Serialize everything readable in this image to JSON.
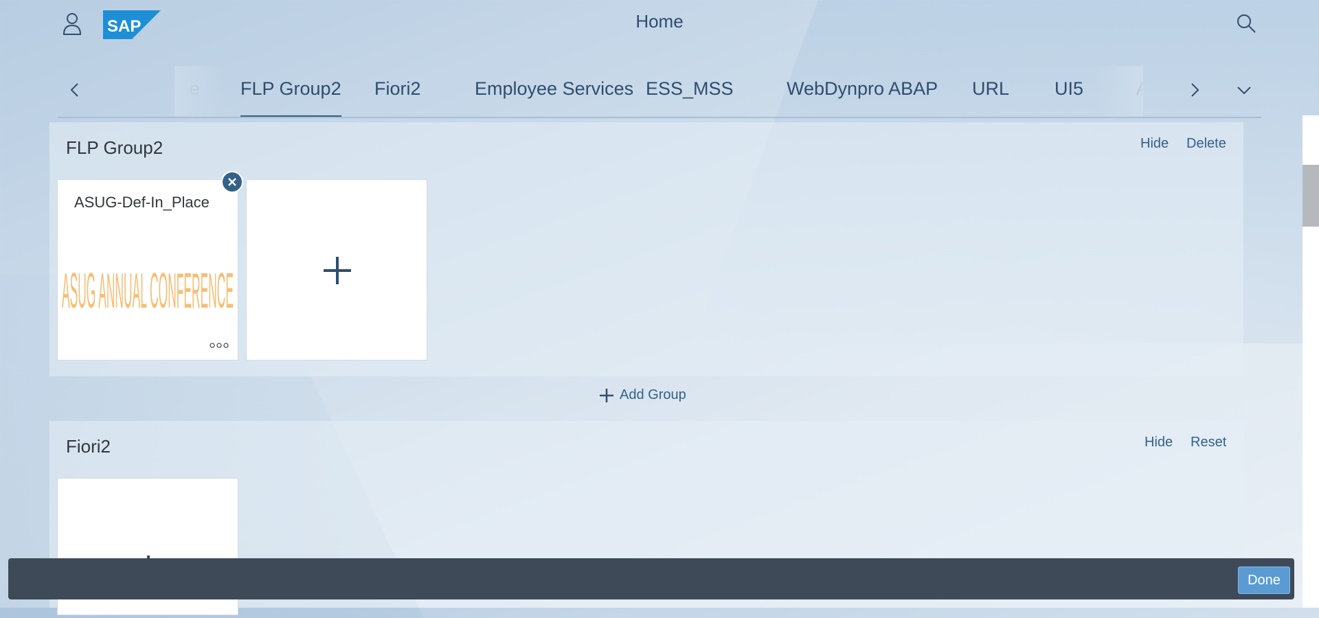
{
  "shell": {
    "title": "Home",
    "logo_text": "SAP",
    "logo_color": "#1e8fd6",
    "user_icon": "person-icon",
    "search_icon": "search-icon"
  },
  "anchor_nav": {
    "tabs": [
      {
        "label": "e",
        "state": "faded"
      },
      {
        "label": "FLP Group2",
        "state": "active"
      },
      {
        "label": "Fiori2",
        "state": "normal"
      },
      {
        "label": "Employee Services",
        "state": "normal"
      },
      {
        "label": "ESS_MSS",
        "state": "normal"
      },
      {
        "label": "WebDynpro ABAP",
        "state": "normal"
      },
      {
        "label": "URL",
        "state": "normal"
      },
      {
        "label": "UI5",
        "state": "normal"
      },
      {
        "label": "AI Transacti",
        "state": "faded"
      }
    ],
    "prev_icon": "chevron-left-icon",
    "next_icon": "chevron-right-icon",
    "overflow_icon": "chevron-down-icon"
  },
  "groups": [
    {
      "title": "FLP Group2",
      "actions": [
        "Hide",
        "Delete"
      ],
      "tiles": [
        {
          "title": "ASUG-Def-In_Place",
          "image_text": "ASUG ANNUAL CONFERENCE",
          "more_icon": "more-icon",
          "badge_icon": "close-icon"
        }
      ],
      "add_tile_icon": "plus-icon"
    },
    {
      "title": "Fiori2",
      "actions": [
        "Hide",
        "Reset"
      ],
      "add_tile_icon": "plus-icon"
    }
  ],
  "add_group_label": "Add Group",
  "footer": {
    "done_label": "Done"
  },
  "colors": {
    "accent": "#346187",
    "footer_bg": "#3e4a58",
    "done_bg": "#5a9bd4"
  }
}
